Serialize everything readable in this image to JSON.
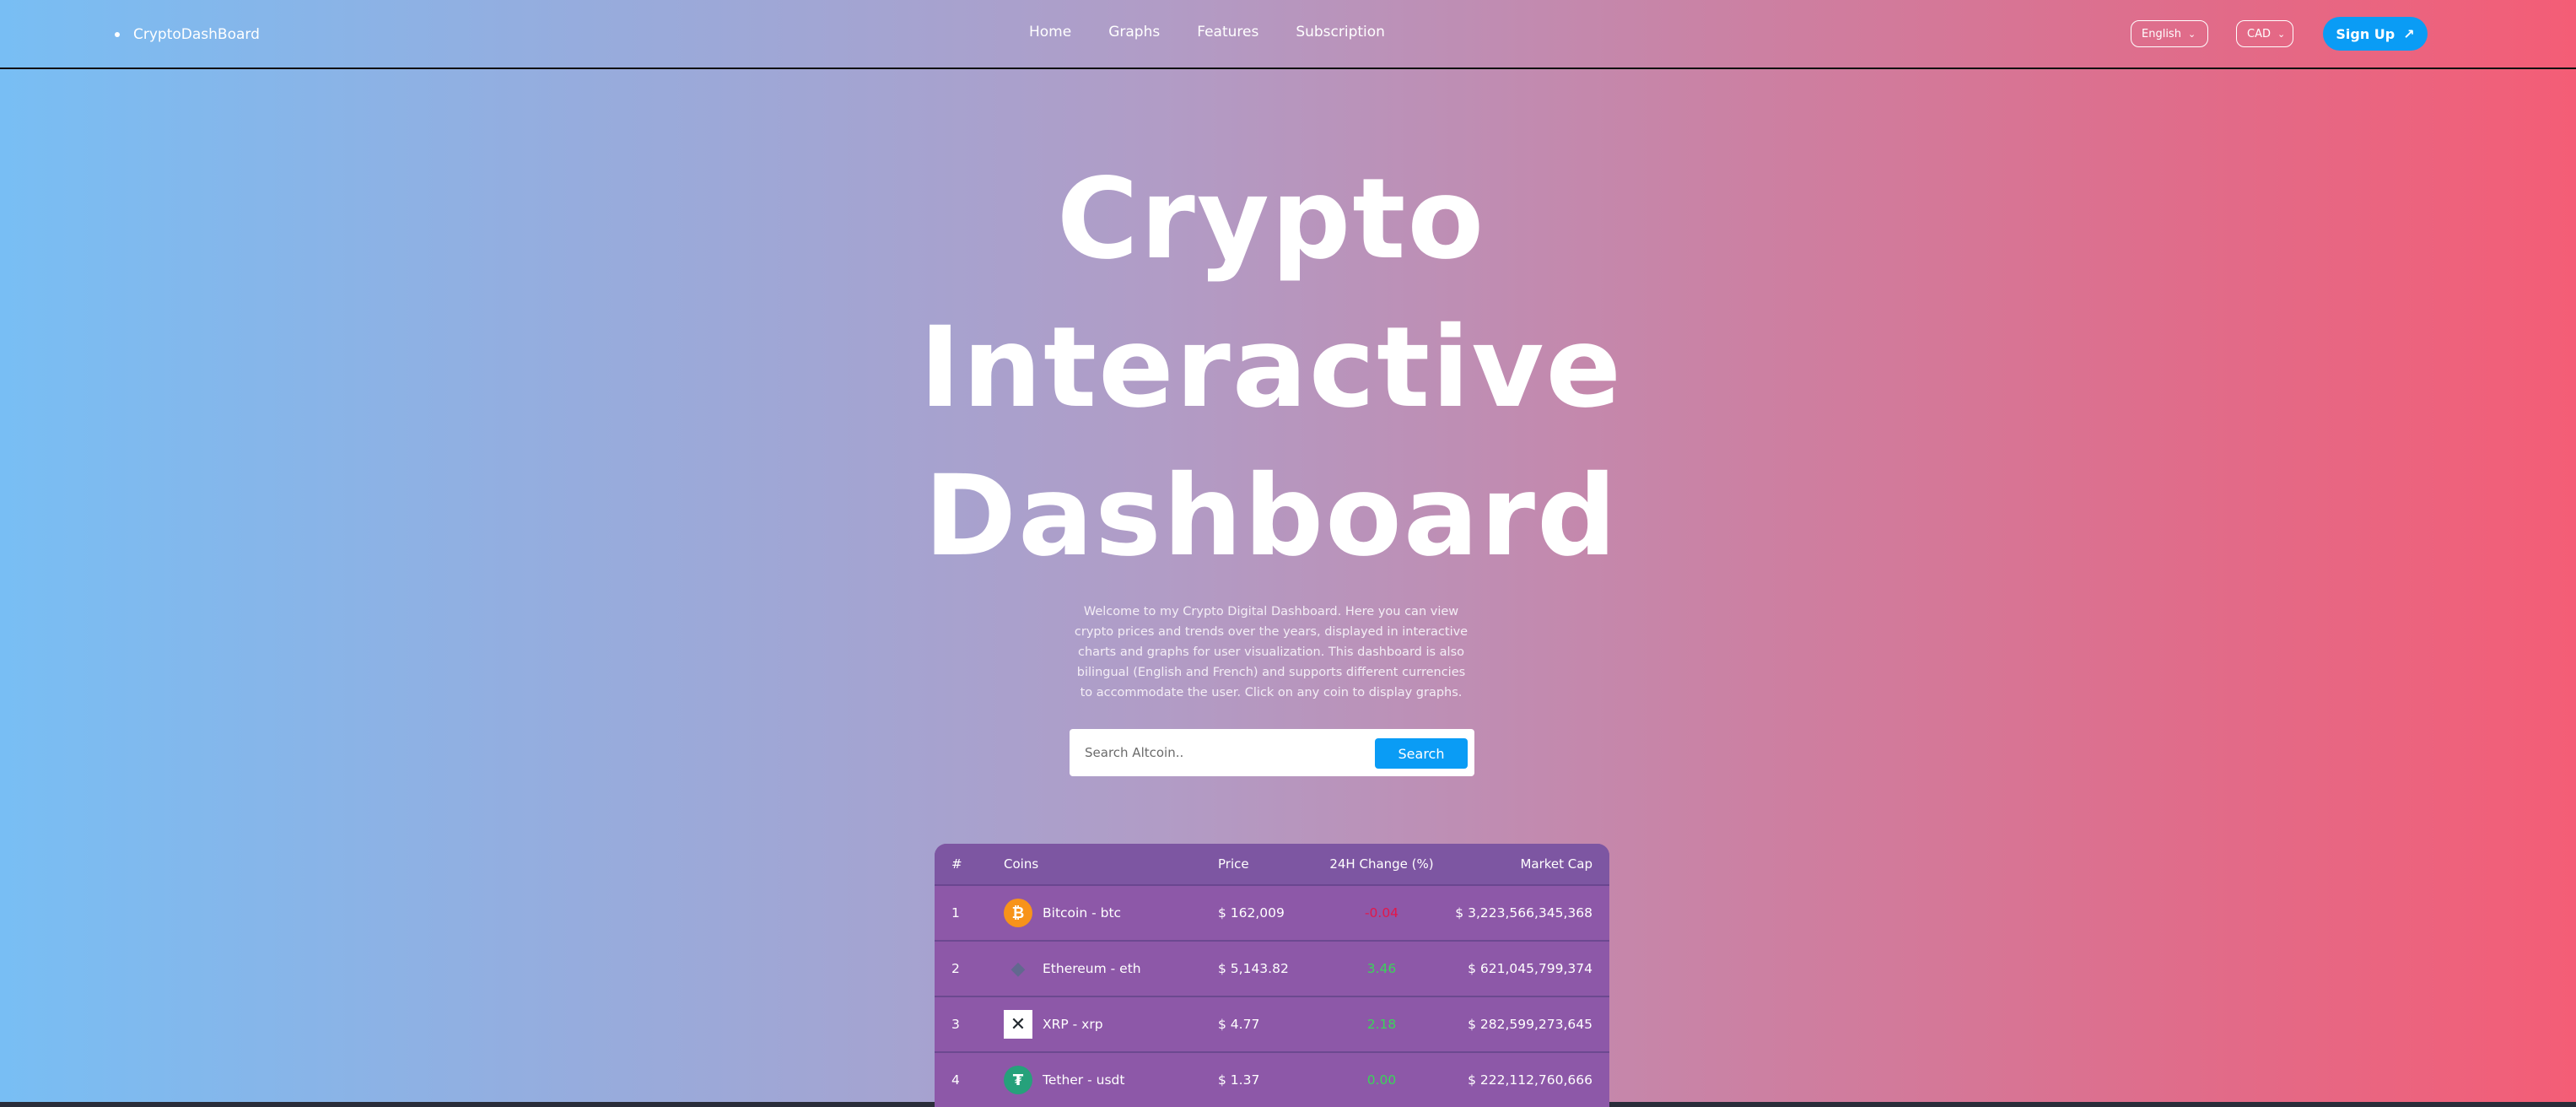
{
  "nav": {
    "brand": "CryptoDashBoard",
    "links": [
      "Home",
      "Graphs",
      "Features",
      "Subscription"
    ],
    "language": "English",
    "currency": "CAD",
    "signup": "Sign Up"
  },
  "hero": {
    "title_lines": [
      "Crypto",
      "Interactive",
      "Dashboard"
    ],
    "description": "Welcome to my Crypto Digital Dashboard. Here you can view crypto prices and trends over the years, displayed in interactive charts and graphs for user visualization. This dashboard is also bilingual (English and French) and supports different currencies to accommodate the user. Click on any coin to display graphs."
  },
  "search": {
    "placeholder": "Search Altcoin..",
    "button": "Search"
  },
  "table": {
    "headers": [
      "#",
      "Coins",
      "Price",
      "24H Change (%)",
      "Market Cap"
    ],
    "rows": [
      {
        "rank": "1",
        "coin": "Bitcoin - btc",
        "icon": "bitcoin-icon",
        "price": "$ 162,009",
        "change": "-0.04",
        "change_dir": "down",
        "cap": "$ 3,223,566,345,368"
      },
      {
        "rank": "2",
        "coin": "Ethereum - eth",
        "icon": "ethereum-icon",
        "price": "$ 5,143.82",
        "change": "3.46",
        "change_dir": "up",
        "cap": "$ 621,045,799,374"
      },
      {
        "rank": "3",
        "coin": "XRP - xrp",
        "icon": "xrp-icon",
        "price": "$ 4.77",
        "change": "2.18",
        "change_dir": "up",
        "cap": "$ 282,599,273,645"
      },
      {
        "rank": "4",
        "coin": "Tether - usdt",
        "icon": "tether-icon",
        "price": "$ 1.37",
        "change": "0.00",
        "change_dir": "up",
        "cap": "$ 222,112,760,666"
      }
    ]
  },
  "colors": {
    "accent": "#0a9cf5",
    "gradient_left": "#78bef4",
    "gradient_right": "#f45d76",
    "negative": "#e3174a",
    "positive": "#3bd45a",
    "table_bg": "#8a5aa8"
  }
}
